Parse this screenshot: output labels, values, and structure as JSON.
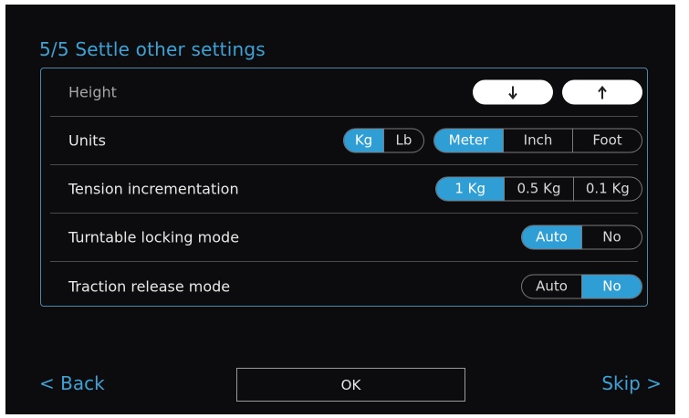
{
  "title": "5/5 Settle other settings",
  "rows": [
    {
      "label": "Height",
      "down_icon": "arrow-down-icon",
      "up_icon": "arrow-up-icon"
    },
    {
      "label": "Units",
      "weight_options": [
        "Kg",
        "Lb"
      ],
      "weight_selected": "Kg",
      "length_options": [
        "Meter",
        "Inch",
        "Foot"
      ],
      "length_selected": "Meter"
    },
    {
      "label": "Tension incrementation",
      "options": [
        "1 Kg",
        "0.5 Kg",
        "0.1 Kg"
      ],
      "selected": "1 Kg"
    },
    {
      "label": "Turntable locking mode",
      "options": [
        "Auto",
        "No"
      ],
      "selected": "Auto"
    },
    {
      "label": "Traction release mode",
      "options": [
        "Auto",
        "No"
      ],
      "selected": "No"
    }
  ],
  "footer": {
    "back": "< Back",
    "ok": "OK",
    "skip": "Skip >"
  },
  "colors": {
    "accent": "#2e9ed4",
    "title": "#3fa2d6",
    "background": "#0c0c0e"
  }
}
